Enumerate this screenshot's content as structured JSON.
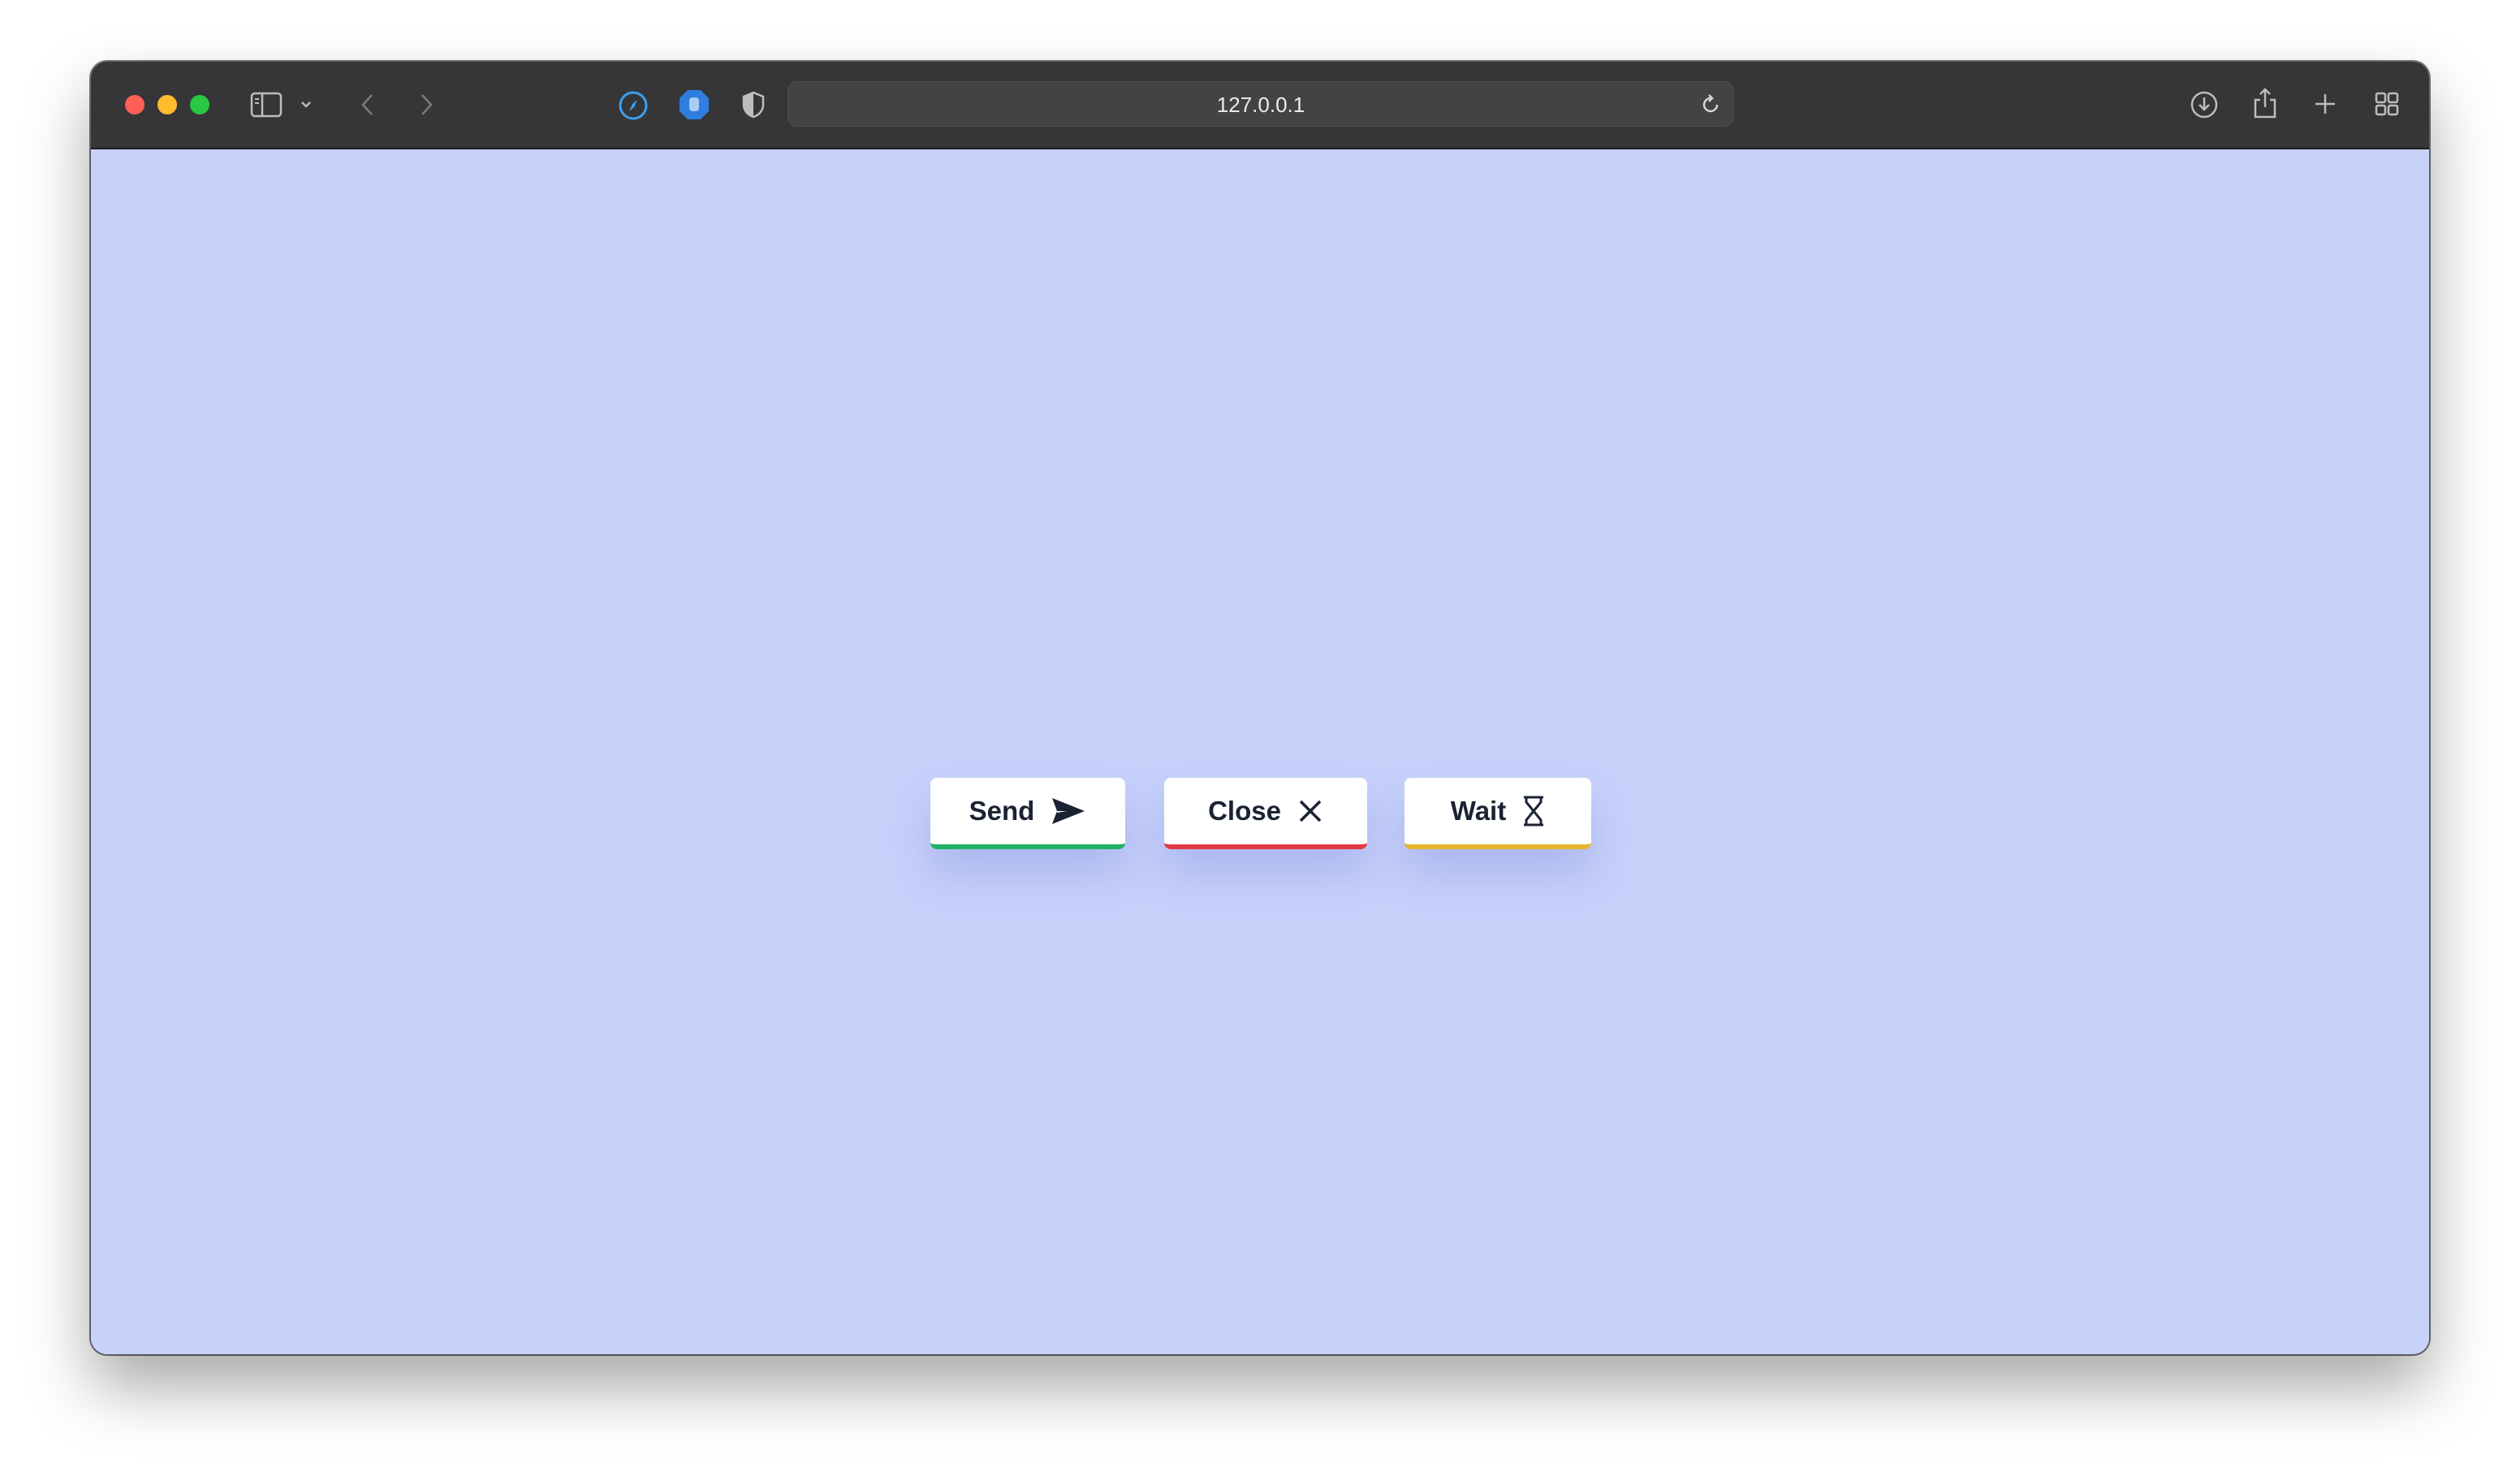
{
  "browser": {
    "url": "127.0.0.1",
    "toolbar_icons": [
      "sidebar-icon",
      "chevron-down-icon",
      "back-icon",
      "forward-icon",
      "compass-extension-icon",
      "hand-extension-icon",
      "privacy-shield-icon",
      "reload-icon",
      "download-icon",
      "share-icon",
      "new-tab-icon",
      "tab-overview-icon"
    ]
  },
  "page": {
    "background": "#c7d1fa",
    "buttons": [
      {
        "label": "Send",
        "icon": "send-icon",
        "accent": "#1fb464"
      },
      {
        "label": "Close",
        "icon": "close-icon",
        "accent": "#e03a43"
      },
      {
        "label": "Wait",
        "icon": "hourglass-icon",
        "accent": "#e6b52c"
      }
    ]
  }
}
